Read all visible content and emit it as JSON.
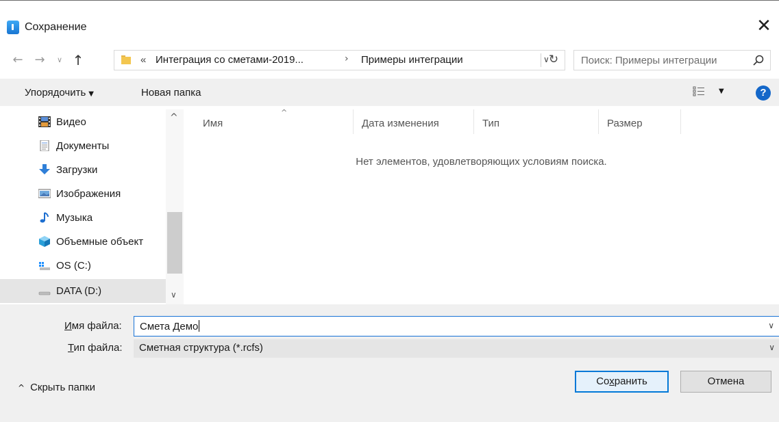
{
  "window": {
    "title": "Сохранение",
    "close_glyph": "✕"
  },
  "nav": {
    "back_glyph": "←",
    "forward_glyph": "→",
    "recent_glyph": "∨",
    "up_glyph": "↑",
    "breadcrumb": {
      "overflow": "«",
      "items": [
        "Интеграция со сметами-2019...",
        "Примеры интеграции"
      ],
      "separator": "›"
    },
    "dropdown_glyph": "∨",
    "refresh_glyph": "↻"
  },
  "search": {
    "placeholder": "Поиск: Примеры интеграции"
  },
  "toolbar": {
    "organize": "Упорядочить",
    "organize_caret": "▼",
    "new_folder": "Новая папка",
    "view_caret": "▼",
    "help": "?"
  },
  "sidebar": {
    "items": [
      {
        "label": "Видео",
        "icon": "video-icon"
      },
      {
        "label": "Документы",
        "icon": "documents-icon"
      },
      {
        "label": "Загрузки",
        "icon": "downloads-icon"
      },
      {
        "label": "Изображения",
        "icon": "pictures-icon"
      },
      {
        "label": "Музыка",
        "icon": "music-icon"
      },
      {
        "label": "Объемные объект",
        "icon": "3d-objects-icon"
      },
      {
        "label": "OS (C:)",
        "icon": "os-drive-icon"
      },
      {
        "label": "DATA (D:)",
        "icon": "drive-icon",
        "selected": true
      }
    ],
    "scroll_up": "^",
    "scroll_down": "∨"
  },
  "file_list": {
    "columns": [
      "Имя",
      "Дата изменения",
      "Тип",
      "Размер"
    ],
    "sort_glyph": "^",
    "empty_message": "Нет элементов, удовлетворяющих условиям поиска."
  },
  "form": {
    "filename_label_ul": "И",
    "filename_label_rest": "мя файла:",
    "filename_value": "Смета Демо",
    "filetype_label_ul": "Т",
    "filetype_label_rest": "ип файла:",
    "filetype_value": "Сметная структура (*.rcfs)",
    "dropdown_glyph": "∨"
  },
  "footer": {
    "hide_folders": "Скрыть папки",
    "hide_glyph": "^",
    "save_pre": "Со",
    "save_ul": "х",
    "save_post": "ранить",
    "cancel": "Отмена"
  },
  "colors": {
    "accent": "#0078d7",
    "help": "#1467c9",
    "folder": "#f3c64f"
  }
}
